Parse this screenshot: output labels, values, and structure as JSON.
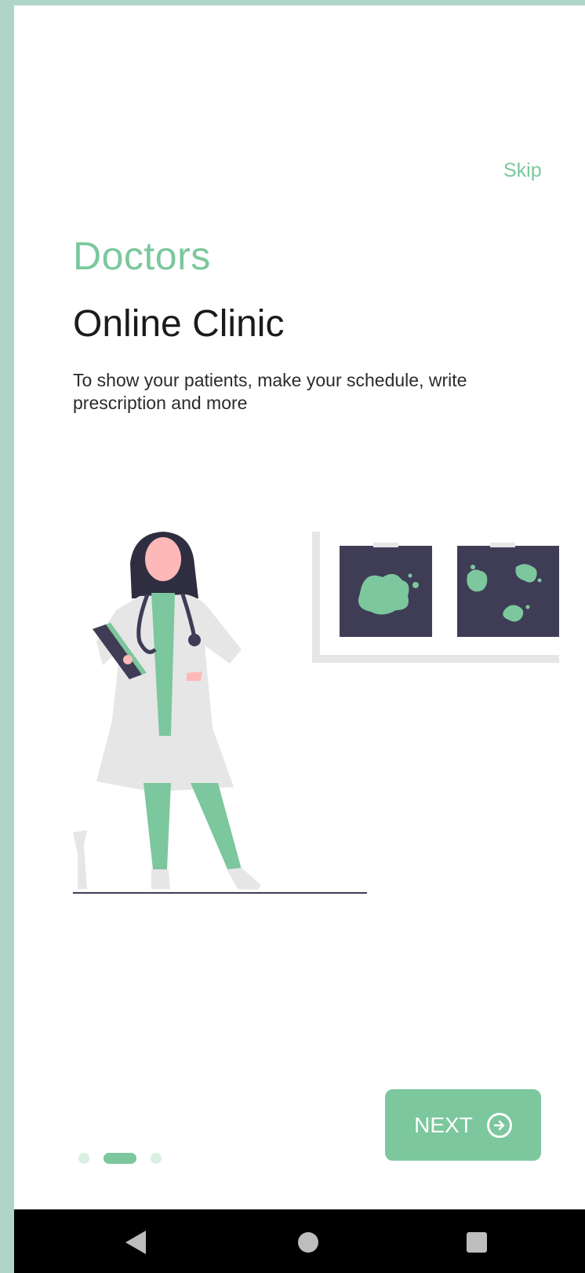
{
  "onboarding": {
    "skip_label": "Skip",
    "eyebrow": "Doctors",
    "title": "Online Clinic",
    "description": "To show your patients, make your schedule, write prescription and more",
    "page_indicator": {
      "total": 3,
      "current": 2
    },
    "next_label": "NEXT"
  },
  "colors": {
    "accent": "#7cc79d",
    "frame": "#afd5c8",
    "dark": "#3f3d56",
    "coat": "#e6e6e6"
  },
  "icons": {
    "next": "arrow-right-circle-icon",
    "nav_back": "back-triangle-icon",
    "nav_home": "home-circle-icon",
    "nav_recent": "recent-apps-square-icon"
  }
}
